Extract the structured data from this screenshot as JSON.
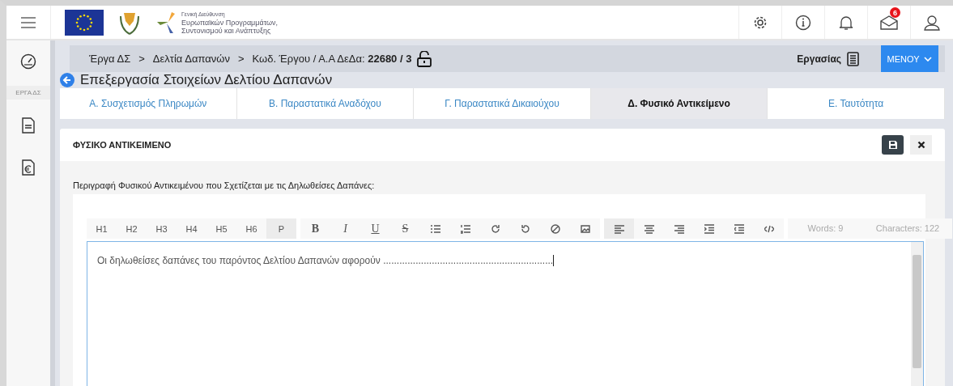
{
  "header": {
    "logo_text": [
      "Γενική Διεύθυνση",
      "Ευρωπαϊκών Προγραμμάτων,",
      "Συντονισμού και Ανάπτυξης"
    ],
    "mail_badge": "6"
  },
  "sidebar": {
    "section_label": "ΕΡΓΑ ΔΣ"
  },
  "breadcrumb": {
    "separator": ">",
    "items": [
      "Έργα ΔΣ",
      "Δελτία Δαπανών",
      "Κωδ. Έργου / Α.Α ΔεΔα: **22680 / 3**"
    ],
    "tasks_label": "Εργασίας",
    "menu_button": "ΜΕΝΟΥ"
  },
  "page_title": "Επεξεργασία Στοιχείων Δελτίου Δαπανών",
  "tabs": [
    {
      "label": "Α. Συσχετισμός Πληρωμών",
      "selected": false
    },
    {
      "label": "Β. Παραστατικά Αναδόχου",
      "selected": false
    },
    {
      "label": "Γ. Παραστατικά Δικαιούχου",
      "selected": false
    },
    {
      "label": "Δ. Φυσικό Αντικείμενο",
      "selected": true
    },
    {
      "label": "Ε. Ταυτότητα",
      "selected": false
    }
  ],
  "card": {
    "title": "ΦΥΣΙΚΟ ΑΝΤΙΚΕΙΜΕΝΟ",
    "field_label": "Περιγραφή Φυσικού Αντικειμένου που Σχετίζεται με τις Δηλωθείσες Δαπάνες:"
  },
  "editor": {
    "toolbar": [
      [
        {
          "kind": "text",
          "label": "H1",
          "selected": false
        },
        {
          "kind": "text",
          "label": "H2",
          "selected": false
        },
        {
          "kind": "text",
          "label": "H3",
          "selected": false
        },
        {
          "kind": "text",
          "label": "H4",
          "selected": false
        },
        {
          "kind": "text",
          "label": "H5",
          "selected": false
        },
        {
          "kind": "text",
          "label": "H6",
          "selected": false
        },
        {
          "kind": "text",
          "label": "P",
          "selected": true
        }
      ],
      [
        {
          "kind": "bold",
          "label": "B",
          "selected": false
        },
        {
          "kind": "italic",
          "label": "I",
          "selected": false
        },
        {
          "kind": "underline",
          "label": "U",
          "selected": false
        },
        {
          "kind": "strike",
          "label": "S",
          "selected": false
        },
        {
          "kind": "bullets",
          "selected": false
        },
        {
          "kind": "numbers",
          "selected": false
        },
        {
          "kind": "redo",
          "selected": false
        },
        {
          "kind": "undo",
          "selected": false
        },
        {
          "kind": "clear",
          "selected": false
        },
        {
          "kind": "image",
          "selected": false
        }
      ],
      [
        {
          "kind": "align-left",
          "selected": true
        },
        {
          "kind": "align-center",
          "selected": false
        },
        {
          "kind": "align-right",
          "selected": false
        },
        {
          "kind": "indent",
          "selected": false
        },
        {
          "kind": "outdent",
          "selected": false
        },
        {
          "kind": "code",
          "selected": false
        }
      ]
    ],
    "words": "Words: 9",
    "characters": "Characters: 122",
    "content": "Οι δηλωθείσες δαπάνες του παρόντος Δελτίου Δαπανών αφορούν ..............................................................."
  }
}
